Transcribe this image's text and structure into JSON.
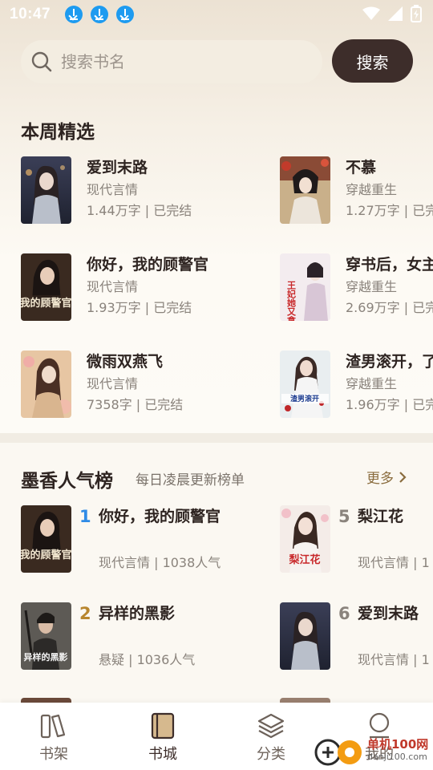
{
  "status_bar": {
    "time": "10:47"
  },
  "search": {
    "placeholder": "搜索书名",
    "button_label": "搜索"
  },
  "weekly": {
    "title": "本周精选",
    "books": [
      {
        "title": "爱到末路",
        "genre": "现代言情",
        "stats": "1.44万字 | 已完结"
      },
      {
        "title": "不慕",
        "genre": "穿越重生",
        "stats": "1.27万字 | 已完"
      },
      {
        "title": "你好，我的顾警官",
        "genre": "现代言情",
        "stats": "1.93万字 | 已完结"
      },
      {
        "title": "穿书后，女主",
        "genre": "穿越重生",
        "stats": "2.69万字 | 已完"
      },
      {
        "title": "微雨双燕飞",
        "genre": "现代言情",
        "stats": "7358字 | 已完结"
      },
      {
        "title": "渣男滚开，了",
        "genre": "穿越重生",
        "stats": "1.96万字 | 已完"
      }
    ]
  },
  "ranking": {
    "title": "墨香人气榜",
    "subtitle": "每日凌晨更新榜单",
    "more_label": "更多",
    "items": [
      {
        "rank": "1",
        "title": "你好，我的顾警官",
        "stats": "现代言情 | 1038人气",
        "rank_color": "#2f8be6"
      },
      {
        "rank": "5",
        "title": "梨江花",
        "stats": "现代言情 | 1",
        "rank_color": "#8a837c"
      },
      {
        "rank": "2",
        "title": "异样的黑影",
        "stats": "悬疑 | 1036人气",
        "rank_color": "#b8862e"
      },
      {
        "rank": "6",
        "title": "爱到末路",
        "stats": "现代言情 | 1",
        "rank_color": "#8a837c"
      }
    ]
  },
  "cover_text": {
    "gu": "我的顾警官",
    "heiying": "异样的黑影",
    "lijianghua": "梨江花",
    "chuanshu": "王妃她又拿了",
    "zhanan": "渣男滚开"
  },
  "bottom_nav": [
    {
      "label": "书架",
      "icon": "bookshelf-icon"
    },
    {
      "label": "书城",
      "icon": "book-store-icon",
      "active": true
    },
    {
      "label": "分类",
      "icon": "layers-icon"
    },
    {
      "label": "我的",
      "icon": "profile-icon"
    }
  ],
  "watermark": {
    "text": "单机100网",
    "url": "danji100.com"
  },
  "colors": {
    "accent": "#3d2d2a",
    "rank1": "#2f8be6",
    "rank2": "#b8862e",
    "download": "#1e9bf0"
  }
}
